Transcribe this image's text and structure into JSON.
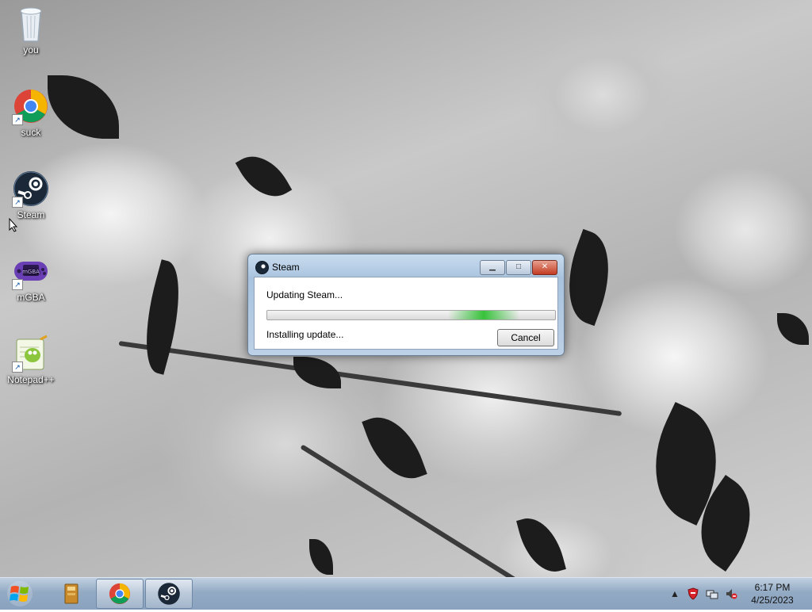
{
  "desktop": {
    "icons": [
      {
        "label": "you",
        "icon": "recycle-bin-icon"
      },
      {
        "label": "suck",
        "icon": "chrome-icon"
      },
      {
        "label": "Steam",
        "icon": "steam-icon"
      },
      {
        "label": "mGBA",
        "icon": "mgba-icon"
      },
      {
        "label": "Notepad++",
        "icon": "notepadpp-icon"
      }
    ]
  },
  "dialog": {
    "title": "Steam",
    "status": "Updating Steam...",
    "substatus": "Installing update...",
    "cancel_label": "Cancel"
  },
  "taskbar": {
    "pinned": [
      {
        "name": "file-explorer",
        "icon": "folder-icon"
      },
      {
        "name": "chrome",
        "icon": "chrome-icon"
      },
      {
        "name": "steam",
        "icon": "steam-icon",
        "active": true
      }
    ],
    "clock": {
      "time": "6:17 PM",
      "date": "4/25/2023"
    }
  },
  "colors": {
    "progress_glow": "#37c23a",
    "steam_dark": "#1b2838",
    "taskbar": "#93aac4"
  }
}
